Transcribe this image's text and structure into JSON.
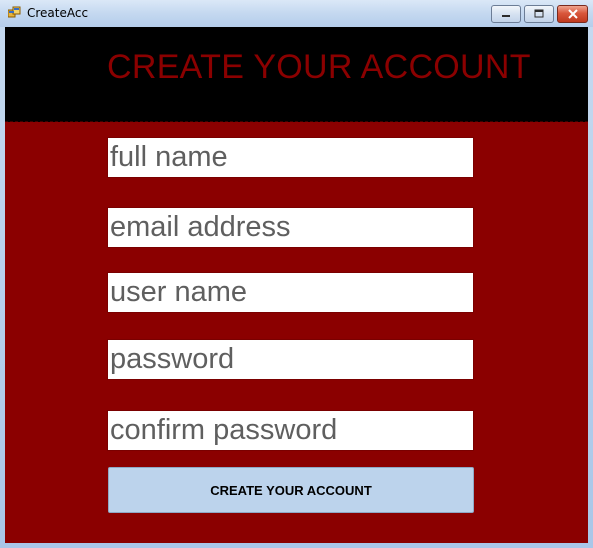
{
  "window": {
    "title": "CreateAcc",
    "icons": {
      "app": "app-icon",
      "minimize": "minimize-icon",
      "maximize": "maximize-icon",
      "close": "close-icon"
    }
  },
  "form": {
    "heading": "CREATE YOUR ACCOUNT",
    "fields": [
      {
        "name": "full-name",
        "placeholder": "full name"
      },
      {
        "name": "email-address",
        "placeholder": "email address"
      },
      {
        "name": "user-name",
        "placeholder": "user name"
      },
      {
        "name": "password",
        "placeholder": "password"
      },
      {
        "name": "confirm-password",
        "placeholder": "confirm password"
      }
    ],
    "submit_label": "CREATE YOUR ACCOUNT"
  },
  "colors": {
    "header_background": "#000000",
    "heading_text": "#8b0000",
    "form_background": "#8b0000",
    "field_text": "#5f5f5f",
    "button_background": "#bcd3ec"
  }
}
